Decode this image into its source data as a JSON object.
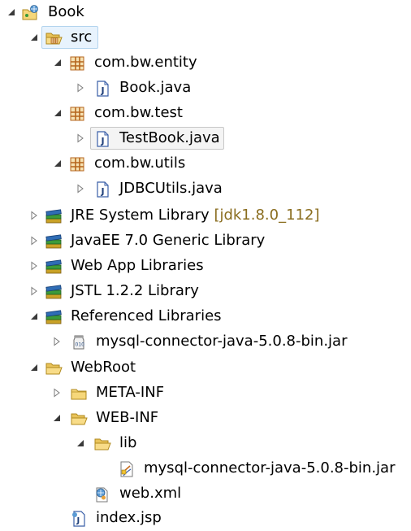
{
  "tree": {
    "project": {
      "label": "Book"
    },
    "src": {
      "label": "src"
    },
    "pkg_entity": {
      "label": "com.bw.entity"
    },
    "file_book": {
      "label": "Book.java"
    },
    "pkg_test": {
      "label": "com.bw.test"
    },
    "file_testbook": {
      "label": "TestBook.java"
    },
    "pkg_utils": {
      "label": "com.bw.utils"
    },
    "file_jdbcutils": {
      "label": "JDBCUtils.java"
    },
    "jre": {
      "label": "JRE System Library",
      "decoration": "[jdk1.8.0_112]"
    },
    "javaee": {
      "label": "JavaEE 7.0 Generic Library"
    },
    "webapp": {
      "label": "Web App Libraries"
    },
    "jstl": {
      "label": "JSTL 1.2.2 Library"
    },
    "refs": {
      "label": "Referenced Libraries"
    },
    "ref_mysql_jar": {
      "label": "mysql-connector-java-5.0.8-bin.jar"
    },
    "webroot": {
      "label": "WebRoot"
    },
    "metainf": {
      "label": "META-INF"
    },
    "webinf": {
      "label": "WEB-INF"
    },
    "lib": {
      "label": "lib"
    },
    "lib_mysql_jar": {
      "label": "mysql-connector-java-5.0.8-bin.jar"
    },
    "webxml": {
      "label": "web.xml"
    },
    "indexjsp": {
      "label": "index.jsp"
    }
  },
  "colors": {
    "folder": "#e8c25a",
    "package": "#b5651d",
    "java_file": "#3a5fa8",
    "library_book_1": "#2f6db5",
    "library_book_2": "#3b9a3b",
    "library_book_3": "#c9a227",
    "decoration_text": "#8a6d1f",
    "selection": "#e8f3fd"
  }
}
